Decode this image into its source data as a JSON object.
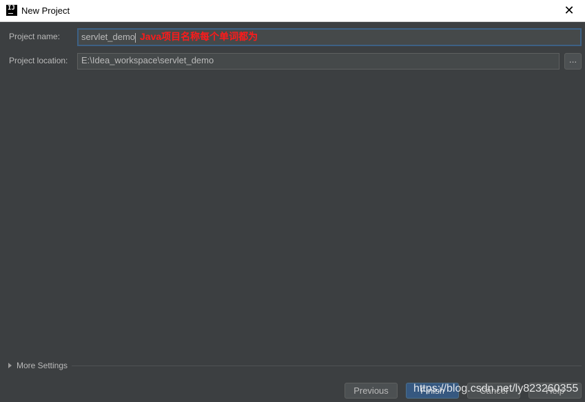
{
  "window": {
    "title": "New Project",
    "close_glyph": "✕",
    "app_icon_text": "IJ"
  },
  "form": {
    "project_name_label": "Project name:",
    "project_name_value": "servlet_demo",
    "project_location_label": "Project location:",
    "project_location_value": "E:\\Idea_workspace\\servlet_demo",
    "browse_label": "..."
  },
  "annotation": "Java项目名称每个单词都为",
  "more_settings_label": "More Settings",
  "buttons": {
    "previous": "Previous",
    "finish": "Finish",
    "cancel": "Cancel",
    "help": "Help"
  },
  "watermark": "https://blog.csdn.net/ly823260355",
  "colors": {
    "background": "#3c3f41",
    "focus_border": "#3d6185",
    "default_button": "#365880",
    "annotation": "#ff1a1a"
  }
}
